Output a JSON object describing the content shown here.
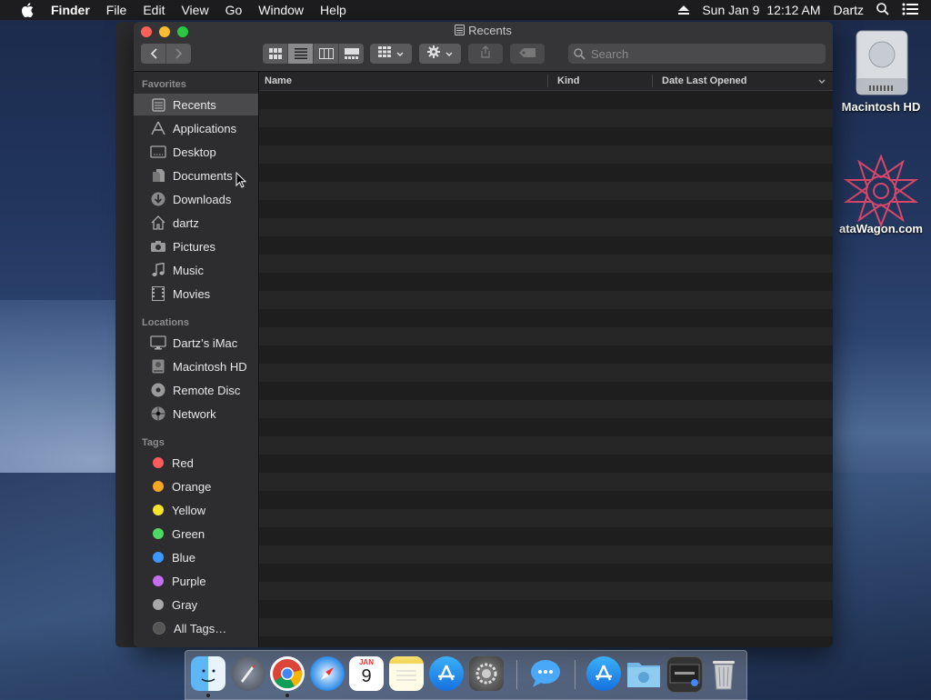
{
  "menubar": {
    "app": "Finder",
    "items": [
      "File",
      "Edit",
      "View",
      "Go",
      "Window",
      "Help"
    ],
    "date": "Sun Jan 9",
    "time": "12:12 AM",
    "user": "Dartz"
  },
  "desktop": {
    "icons": [
      {
        "label": "Macintosh HD",
        "icon": "hard-drive-icon"
      },
      {
        "label": "ataWagon.com",
        "icon": "mandala-icon"
      }
    ]
  },
  "window": {
    "title": "Recents",
    "search_placeholder": "Search",
    "columns": {
      "name": "Name",
      "kind": "Kind",
      "date": "Date Last Opened"
    }
  },
  "sidebar": {
    "favorites_title": "Favorites",
    "favorites": [
      {
        "label": "Recents",
        "icon": "recents-icon",
        "selected": true
      },
      {
        "label": "Applications",
        "icon": "applications-icon"
      },
      {
        "label": "Desktop",
        "icon": "desktop-icon"
      },
      {
        "label": "Documents",
        "icon": "documents-icon"
      },
      {
        "label": "Downloads",
        "icon": "downloads-icon"
      },
      {
        "label": "dartz",
        "icon": "home-icon"
      },
      {
        "label": "Pictures",
        "icon": "camera-icon"
      },
      {
        "label": "Music",
        "icon": "music-icon"
      },
      {
        "label": "Movies",
        "icon": "film-icon"
      }
    ],
    "locations_title": "Locations",
    "locations": [
      {
        "label": "Dartz’s iMac",
        "icon": "imac-icon"
      },
      {
        "label": "Macintosh HD",
        "icon": "hard-drive-icon"
      },
      {
        "label": "Remote Disc",
        "icon": "disc-icon"
      },
      {
        "label": "Network",
        "icon": "network-icon"
      }
    ],
    "tags_title": "Tags",
    "tags": [
      {
        "label": "Red",
        "color": "#ff5b5b"
      },
      {
        "label": "Orange",
        "color": "#f5a623"
      },
      {
        "label": "Yellow",
        "color": "#f7e32e"
      },
      {
        "label": "Green",
        "color": "#4cd964"
      },
      {
        "label": "Blue",
        "color": "#3b99fc"
      },
      {
        "label": "Purple",
        "color": "#c56ef0"
      },
      {
        "label": "Gray",
        "color": "#a8a8a8"
      },
      {
        "label": "All Tags…",
        "color": "#555555"
      }
    ]
  },
  "dock": {
    "apps": [
      "Finder",
      "Launchpad",
      "Chrome",
      "Safari",
      "Calendar",
      "Notes",
      "App Store",
      "System Preferences",
      "Messages",
      "App Store Folder",
      "Folder",
      "Screenshot",
      "Trash"
    ],
    "calendar_month": "JAN",
    "calendar_day": "9"
  },
  "colors": {
    "selected_row": "#4a4a4c",
    "sidebar_bg": "#2d2d2f",
    "list_bg": "#1e1e1e"
  }
}
